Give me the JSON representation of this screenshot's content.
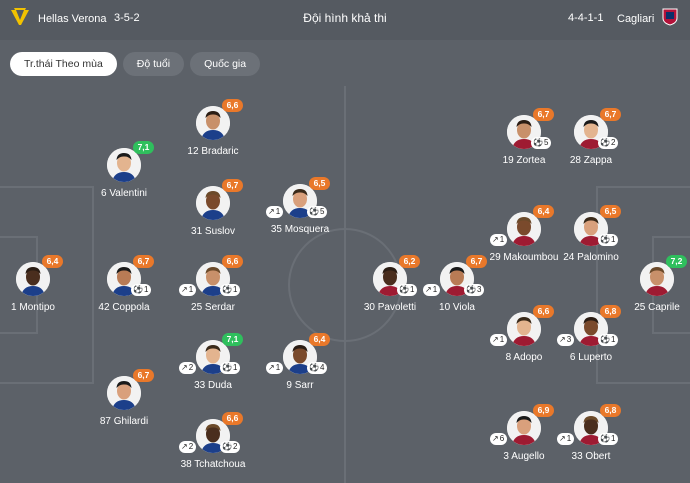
{
  "header": {
    "home_team": "Hellas Verona",
    "home_formation": "3-5-2",
    "title": "Đội hình khả thi",
    "away_formation": "4-4-1-1",
    "away_team": "Cagliari"
  },
  "tabs": [
    "Tr.thái Theo mùa",
    "Độ tuổi",
    "Quốc gia"
  ],
  "colors": {
    "orange": "#e9782a",
    "green": "#2fbf5d"
  },
  "home_players": [
    {
      "name": "12 Bradaric",
      "rating": "6,6",
      "rc": "orange"
    },
    {
      "name": "6 Valentini",
      "rating": "7,1",
      "rc": "green"
    },
    {
      "name": "31 Suslov",
      "rating": "6,7",
      "rc": "orange"
    },
    {
      "name": "35 Mosquera",
      "rating": "6,5",
      "rc": "orange",
      "assists": "1",
      "goals": "5"
    },
    {
      "name": "1 Montipo",
      "rating": "6,4",
      "rc": "orange"
    },
    {
      "name": "42 Coppola",
      "rating": "6,7",
      "rc": "orange",
      "goals": "1"
    },
    {
      "name": "25 Serdar",
      "rating": "6,6",
      "rc": "orange",
      "assists": "1",
      "goals": "1"
    },
    {
      "name": "33 Duda",
      "rating": "7,1",
      "rc": "green",
      "assists": "2",
      "goals": "1"
    },
    {
      "name": "9 Sarr",
      "rating": "6,4",
      "rc": "orange",
      "assists": "1",
      "goals": "4"
    },
    {
      "name": "87 Ghilardi",
      "rating": "6,7",
      "rc": "orange"
    },
    {
      "name": "38 Tchatchoua",
      "rating": "6,6",
      "rc": "orange",
      "assists": "2",
      "goals": "2"
    }
  ],
  "away_players": [
    {
      "name": "19 Zortea",
      "rating": "6,7",
      "rc": "orange",
      "goals": "5"
    },
    {
      "name": "28 Zappa",
      "rating": "6,7",
      "rc": "orange",
      "goals": "2"
    },
    {
      "name": "29 Makoumbou",
      "rating": "6,4",
      "rc": "orange",
      "assists": "1"
    },
    {
      "name": "24 Palomino",
      "rating": "6,5",
      "rc": "orange",
      "goals": "1"
    },
    {
      "name": "30 Pavoletti",
      "rating": "6,2",
      "rc": "orange",
      "goals": "1"
    },
    {
      "name": "10 Viola",
      "rating": "6,7",
      "rc": "orange",
      "assists": "1",
      "goals": "3"
    },
    {
      "name": "25 Caprile",
      "rating": "7,2",
      "rc": "green"
    },
    {
      "name": "8 Adopo",
      "rating": "6,6",
      "rc": "orange",
      "assists": "1"
    },
    {
      "name": "6 Luperto",
      "rating": "6,8",
      "rc": "orange",
      "assists": "3",
      "goals": "1"
    },
    {
      "name": "3 Augello",
      "rating": "6,9",
      "rc": "orange",
      "assists": "6"
    },
    {
      "name": "33 Obert",
      "rating": "6,8",
      "rc": "orange",
      "assists": "1",
      "goals": "1"
    }
  ]
}
